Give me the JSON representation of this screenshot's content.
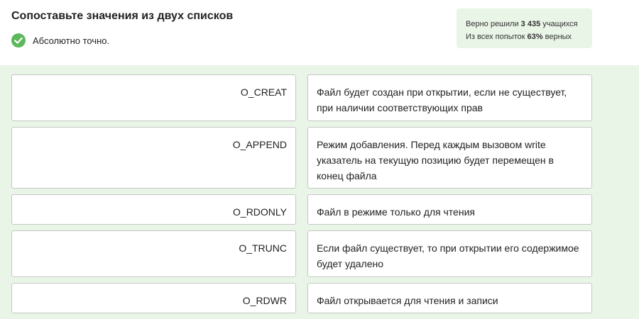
{
  "title": "Сопоставьте значения из двух списков",
  "status": {
    "text": "Абсолютно точно.",
    "icon": "check-circle-icon",
    "icon_color": "#5cb85c"
  },
  "stats": {
    "solved_prefix": "Верно решили",
    "solved_count": "3 435",
    "solved_suffix": "учащихся",
    "attempts_prefix": "Из всех попыток",
    "attempts_percent": "63%",
    "attempts_suffix": "верных"
  },
  "colors": {
    "panel_bg": "#e9f5e6",
    "box_border": "#c7c7c7"
  },
  "pairs": [
    {
      "key": "O_CREAT",
      "value": "Файл будет создан при открытии, если не существует, при наличии соответствующих прав"
    },
    {
      "key": "O_APPEND",
      "value": "Режим добавления. Перед каждым вызовом write указатель на текущую позицию будет перемещен в конец файла"
    },
    {
      "key": "O_RDONLY",
      "value": "Файл в режиме только для чтения"
    },
    {
      "key": "O_TRUNC",
      "value": "Если файл существует, то при открытии его содержимое будет удалено"
    },
    {
      "key": "O_RDWR",
      "value": "Файл открывается для чтения и записи"
    }
  ]
}
